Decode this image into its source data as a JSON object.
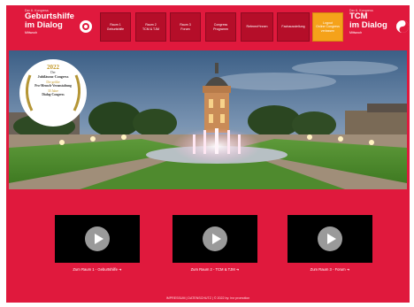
{
  "brand_left": {
    "tiny": "Der 6. Kongress",
    "line1": "Geburtshilfe",
    "line2": "im Dialog",
    "sub": "Mittwoch"
  },
  "brand_right": {
    "tiny": "Der 6. Kongress",
    "line1": "TCM",
    "line2": "im Dialog",
    "sub": "Mittwoch"
  },
  "nav": [
    {
      "l1": "Raum 1",
      "l2": "Geburtshilfe"
    },
    {
      "l1": "Raum 2",
      "l2": "TCM & TJM"
    },
    {
      "l1": "Raum 3",
      "l2": "Forum"
    },
    {
      "l1": "Congress",
      "l2": "Programm"
    },
    {
      "l1": "Referent*innen",
      "l2": ""
    },
    {
      "l1": "Fachausstellung",
      "l2": ""
    },
    {
      "l1": "Logout",
      "l2": "Online Congress verlassen"
    }
  ],
  "badge": {
    "year": "2022",
    "l1": "Der",
    "l2": "Jubiläums-Congress",
    "l3": "Die größte",
    "l4": "Pro-Mensch-Veranstaltung",
    "l5": "30 Jahre",
    "l6": "Dialog-Congress"
  },
  "videos": [
    {
      "link": "Zum Raum 1 - Geburtshilfe ➜"
    },
    {
      "link": "Zum Raum 2 - TCM & TJM ➜"
    },
    {
      "link": "Zum Raum 3 - Forum ➜"
    }
  ],
  "footer": "IMPRESSUM | DATENSCHUTZ | © 2022 by: hvr promotion",
  "colors": {
    "background": "#e0193d",
    "nav": "#b50e29",
    "nav_active": "#f5a21a",
    "video": "#000000"
  }
}
